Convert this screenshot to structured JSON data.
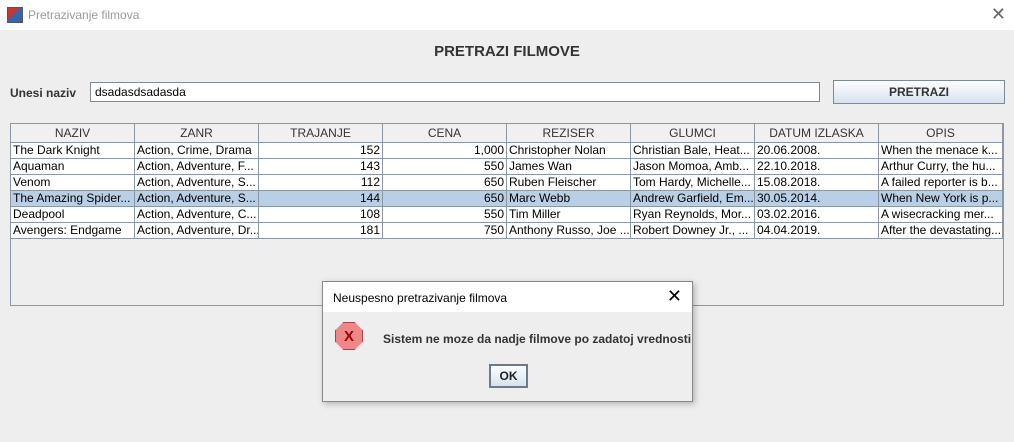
{
  "window": {
    "title": "Pretrazivanje filmova",
    "close": "✕"
  },
  "heading": "PRETRAZI FILMOVE",
  "search": {
    "label": "Unesi naziv",
    "value": "dsadasdsadasda",
    "button": "PRETRAZI"
  },
  "table": {
    "columns": [
      "NAZIV",
      "ZANR",
      "TRAJANJE",
      "CENA",
      "REZISER",
      "GLUMCI",
      "DATUM IZLASKA",
      "OPIS"
    ],
    "rows": [
      [
        "The Dark Knight",
        "Action, Crime, Drama",
        "152",
        "1,000",
        "Christopher Nolan",
        "Christian Bale, Heat...",
        "20.06.2008.",
        "When the menace k..."
      ],
      [
        "Aquaman",
        "Action, Adventure, F...",
        "143",
        "550",
        "James Wan",
        "Jason Momoa, Amb...",
        "22.10.2018.",
        "Arthur Curry, the hu..."
      ],
      [
        "Venom",
        "Action, Adventure, S...",
        "112",
        "650",
        "Ruben Fleischer",
        "Tom Hardy, Michelle...",
        "15.08.2018.",
        "A failed reporter is b..."
      ],
      [
        "The Amazing Spider...",
        "Action, Adventure, S...",
        "144",
        "650",
        "Marc Webb",
        "Andrew Garfield, Em...",
        "30.05.2014.",
        "When New York is p..."
      ],
      [
        "Deadpool",
        "Action, Adventure, C...",
        "108",
        "550",
        "Tim Miller",
        "Ryan Reynolds, Mor...",
        "03.02.2016.",
        "A wisecracking mer..."
      ],
      [
        "Avengers: Endgame",
        "Action, Adventure, Dr...",
        "181",
        "750",
        "Anthony Russo, Joe ...",
        "Robert Downey Jr., ...",
        "04.04.2019.",
        "After the devastating..."
      ]
    ],
    "selected_row": 3
  },
  "dialog": {
    "title": "Neuspesno pretrazivanje filmova",
    "close": "✕",
    "icon_glyph": "X",
    "message": "Sistem ne moze da nadje filmove po zadatoj vrednosti",
    "ok": "OK"
  }
}
